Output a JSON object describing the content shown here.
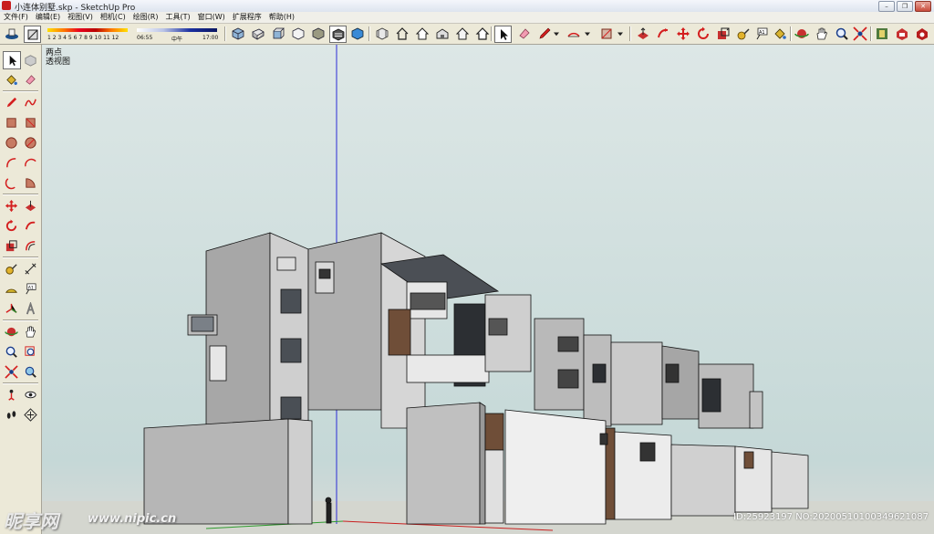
{
  "window": {
    "title": "小连体别墅.skp - SketchUp Pro",
    "controls": {
      "minimize": "–",
      "restore": "❐",
      "close": "✕"
    }
  },
  "menu": {
    "items": [
      "文件(F)",
      "编辑(E)",
      "视图(V)",
      "相机(C)",
      "绘图(R)",
      "工具(T)",
      "窗口(W)",
      "扩展程序",
      "帮助(H)"
    ]
  },
  "shadow_panel": {
    "month_scale": "1 2 3 4 5 6 7 8 9 10 11 12",
    "time_start": "06:55",
    "time_mid": "中午",
    "time_end": "17:00"
  },
  "viewport": {
    "scene_label": "两点",
    "view_label": "透视图",
    "axis_color": "#2b2bd6",
    "sky_color": "#dde7e6"
  },
  "watermark": {
    "logo": "昵享网",
    "site": "www.nipic.cn",
    "id": "ID:25923197 NO:20200510100349621087"
  }
}
